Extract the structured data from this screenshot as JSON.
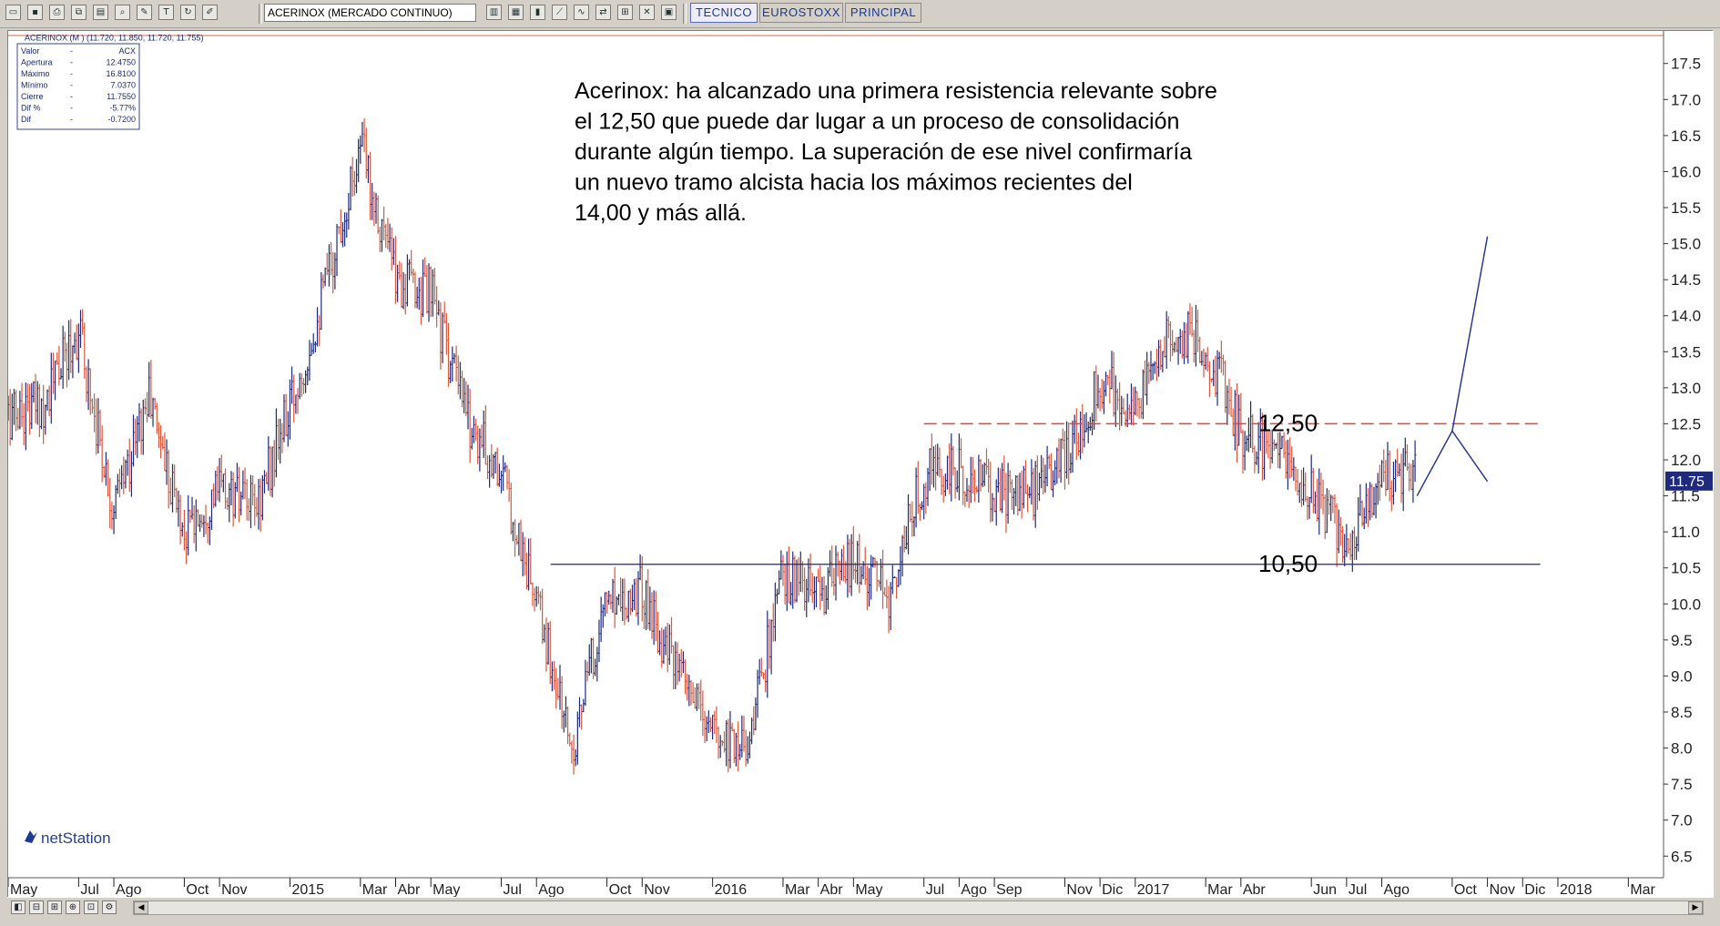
{
  "toolbar": {
    "symbol": "ACERINOX (MERCADO CONTINUO)",
    "tabs": [
      "TECNICO",
      "EUROSTOXX",
      "PRINCIPAL"
    ],
    "active_tab": "TECNICO"
  },
  "chart_header": "ACERINOX (M ) (11.720, 11.850, 11.720, 11.755)",
  "info_table": [
    {
      "label": "Valor",
      "value": "ACX"
    },
    {
      "label": "Apertura",
      "value": "12.4750"
    },
    {
      "label": "Máximo",
      "value": "16.8100"
    },
    {
      "label": "Mínimo",
      "value": "7.0370"
    },
    {
      "label": "Cierre",
      "value": "11.7550"
    },
    {
      "label": "Dif %",
      "value": "-5.77%"
    },
    {
      "label": "Dif",
      "value": "-0.7200"
    }
  ],
  "annotation": [
    "Acerinox:  ha alcanzado una primera resistencia relevante sobre",
    "el 12,50 que puede dar lugar a un proceso de consolidación",
    "durante algún tiempo. La superación de ese nivel confirmaría",
    "un nuevo tramo alcista hacia los máximos recientes del",
    "14,00 y más allá."
  ],
  "level_labels": {
    "resistance": "12,50",
    "support": "10,50"
  },
  "current_price_label": "11.75",
  "brand": "netStation",
  "colors": {
    "resistance_line": "#e8403a",
    "support_line": "#1f2a7c",
    "projection_line": "#2a3a8c",
    "candle_up": "#1d2a7a",
    "candle_down": "#d9583a",
    "price_tag_bg": "#1f2a7c"
  },
  "chart_data": {
    "type": "line",
    "y_axis_ticks": [
      "17.5",
      "17.0",
      "16.5",
      "16.0",
      "15.5",
      "15.0",
      "14.5",
      "14.0",
      "13.5",
      "13.0",
      "12.5",
      "12.0",
      "11.5",
      "11.0",
      "10.5",
      "10.0",
      "9.5",
      "9.0",
      "8.5",
      "8.0",
      "7.5",
      "7.0",
      "6.5"
    ],
    "ylim": [
      6.2,
      17.8
    ],
    "x_axis_ticks": [
      "May",
      "Jul",
      "Ago",
      "Oct",
      "Nov",
      "2015",
      "Mar",
      "Abr",
      "May",
      "Jul",
      "Ago",
      "Oct",
      "Nov",
      "2016",
      "Mar",
      "Abr",
      "May",
      "Jul",
      "Ago",
      "Sep",
      "Nov",
      "Dic",
      "2017",
      "Mar",
      "Abr",
      "Jun",
      "Jul",
      "Ago",
      "Oct",
      "Nov",
      "Dic",
      "2018",
      "Mar"
    ],
    "x_tick_dates": [
      "2014-05",
      "2014-07",
      "2014-08",
      "2014-10",
      "2014-11",
      "2015-01",
      "2015-03",
      "2015-04",
      "2015-05",
      "2015-07",
      "2015-08",
      "2015-10",
      "2015-11",
      "2016-01",
      "2016-03",
      "2016-04",
      "2016-05",
      "2016-07",
      "2016-08",
      "2016-09",
      "2016-11",
      "2016-12",
      "2017-01",
      "2017-03",
      "2017-04",
      "2017-06",
      "2017-07",
      "2017-08",
      "2017-10",
      "2017-11",
      "2017-12",
      "2018-01",
      "2018-03"
    ],
    "xlim": [
      "2014-05",
      "2018-04"
    ],
    "series": [
      {
        "x": [
          "2014-05",
          "2014-06",
          "2014-07",
          "2014-08",
          "2014-09",
          "2014-10",
          "2014-11",
          "2014-12",
          "2015-01",
          "2015-02",
          "2015-03",
          "2015-04",
          "2015-05",
          "2015-06",
          "2015-07",
          "2015-08",
          "2015-09",
          "2015-10",
          "2015-11",
          "2015-12",
          "2016-01",
          "2016-02",
          "2016-03",
          "2016-04",
          "2016-05",
          "2016-06",
          "2016-07",
          "2016-08",
          "2016-09",
          "2016-10",
          "2016-11",
          "2016-12",
          "2017-01",
          "2017-02",
          "2017-03",
          "2017-04",
          "2017-05",
          "2017-06",
          "2017-07",
          "2017-08",
          "2017-09"
        ],
        "values": [
          12.6,
          12.8,
          13.8,
          11.3,
          12.9,
          11.0,
          11.6,
          11.3,
          12.7,
          14.4,
          16.4,
          14.5,
          14.3,
          12.6,
          11.8,
          10.0,
          8.0,
          10.1,
          10.2,
          9.0,
          8.2,
          8.1,
          10.4,
          10.1,
          10.6,
          10.1,
          11.8,
          11.8,
          11.6,
          11.5,
          12.0,
          13.1,
          12.7,
          13.8,
          13.6,
          12.4,
          12.1,
          11.6,
          10.9,
          11.8,
          11.8
        ]
      },
      {
        "name": "",
        "type": "hline",
        "values": [
          12.5
        ]
      },
      {
        "name": "",
        "type": "hline",
        "values": [
          10.55
        ]
      },
      {
        "x": [
          "2017-09",
          "2017-10",
          "2017-11"
        ],
        "values": [
          11.5,
          12.4,
          15.1
        ]
      }
    ],
    "projection_pullback": {
      "x": [
        "2017-10",
        "2017-11"
      ],
      "values": [
        12.4,
        11.7
      ]
    }
  }
}
